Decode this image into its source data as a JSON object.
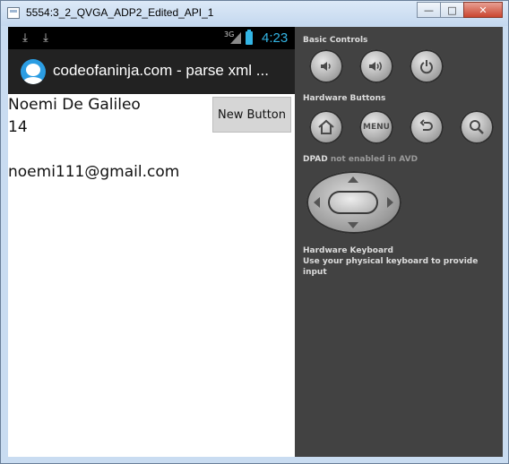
{
  "window": {
    "title": "5554:3_2_QVGA_ADP2_Edited_API_1",
    "minimize_label": "—",
    "maximize_label": "□",
    "close_label": "✕"
  },
  "statusbar": {
    "network": "3G",
    "time": "4:23",
    "icons": [
      "download-icon",
      "download-icon",
      "signal-icon",
      "battery-icon"
    ],
    "accent_color": "#33b5e5"
  },
  "actionbar": {
    "title": "codeofaninja.com - parse xml ..."
  },
  "content": {
    "name": "Noemi De Galileo",
    "age": "14",
    "email": "noemi111@gmail.com",
    "button_label": "New Button"
  },
  "controls": {
    "basic_controls_label": "Basic Controls",
    "basic_buttons": [
      "volume-down-icon",
      "volume-up-icon",
      "power-icon"
    ],
    "hardware_buttons_label": "Hardware Buttons",
    "hardware_buttons": [
      "home-icon",
      "menu",
      "back-icon",
      "search-icon"
    ],
    "menu_label": "MENU",
    "dpad_label": "DPAD",
    "dpad_note": "not enabled in AVD",
    "keyboard_title": "Hardware Keyboard",
    "keyboard_note": "Use your physical keyboard to provide input"
  }
}
